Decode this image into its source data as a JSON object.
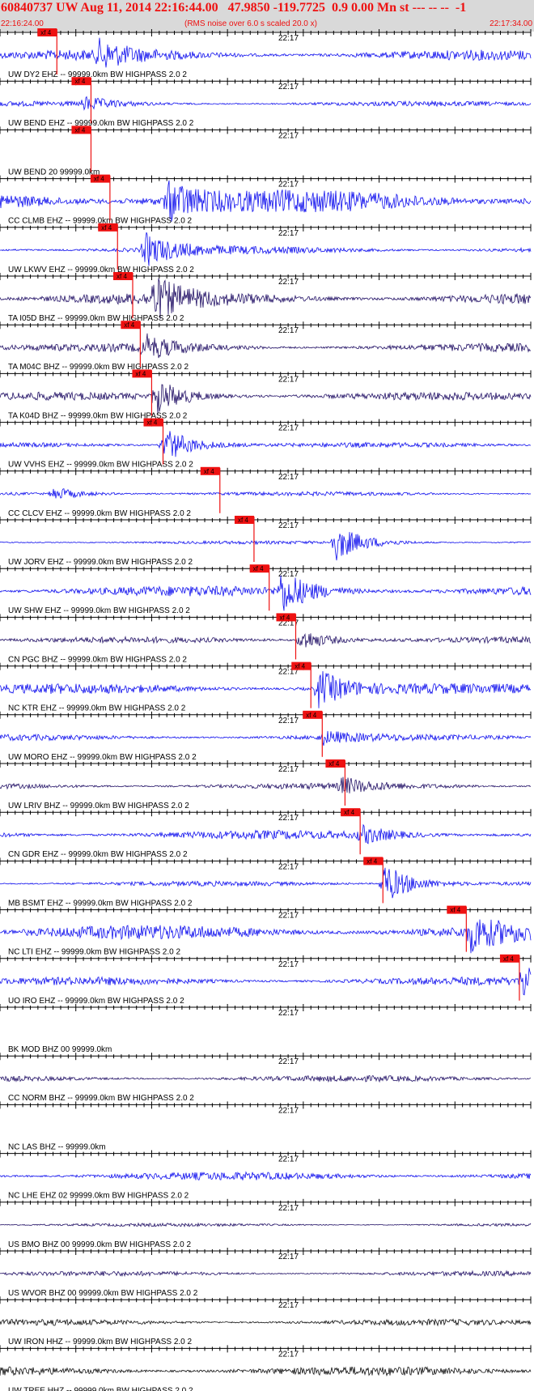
{
  "header": {
    "title": "60840737 UW Aug 11, 2014 22:16:44.00   47.9850 -119.7725  0.9 0.00 Mn st --- -- --  -1",
    "start_time": "22:16:24.00",
    "end_time": "22:17:34.00",
    "rms_note": "(RMS noise over 6.0 s scaled 20.0 x)"
  },
  "colors": {
    "trace_blue": "#1010ee",
    "trace_dark": "#221166",
    "trace_black": "#111111",
    "pick_red": "#ee1111",
    "axis": "#000000",
    "header_bg": "#d9d9d9"
  },
  "chart_data": {
    "type": "line",
    "x_range_seconds": [
      0,
      70
    ],
    "x_start_label": "22:16:24.00",
    "x_end_label": "22:17:34.00",
    "center_tick_label": "22:17",
    "pick_label": "xf 4",
    "traces": [
      {
        "label": "UW DY2 EHZ -- 99999.0km BW  HIGHPASS  2.0  2",
        "pick_s": 7.5,
        "color": "trace_blue",
        "noise": 0.25,
        "burst_s": 13,
        "burst_amp": 0.6
      },
      {
        "label": "UW BEND EHZ -- 99999.0km BW  HIGHPASS  2.0  2",
        "pick_s": 12.0,
        "color": "trace_blue",
        "noise": 0.12,
        "burst_s": 11,
        "burst_amp": 0.3
      },
      {
        "label": "UW BEND 20 99999.0km",
        "pick_s": 12.0,
        "color": "none",
        "noise": 0,
        "burst_s": 0,
        "burst_amp": 0
      },
      {
        "label": "CC CLMB EHZ -- 99999.0km BW  HIGHPASS  2.0  2",
        "pick_s": 14.5,
        "color": "trace_blue",
        "noise": 0.55,
        "burst_s": 22,
        "burst_amp": 1.0
      },
      {
        "label": "UW LKWV EHZ -- 99999.0km BW  HIGHPASS  2.0  2",
        "pick_s": 15.5,
        "color": "trace_blue",
        "noise": 0.18,
        "burst_s": 19,
        "burst_amp": 0.8
      },
      {
        "label": "TA I05D BHZ -- 99999.0km BW  HIGHPASS  2.0  2",
        "pick_s": 17.5,
        "color": "trace_dark",
        "noise": 0.3,
        "burst_s": 20,
        "burst_amp": 1.0
      },
      {
        "label": "TA M04C BHZ -- 99999.0km BW  HIGHPASS  2.0  2",
        "pick_s": 18.5,
        "color": "trace_dark",
        "noise": 0.2,
        "burst_s": 19,
        "burst_amp": 0.55
      },
      {
        "label": "TA K04D BHZ -- 99999.0km BW  HIGHPASS  2.0  2",
        "pick_s": 20.0,
        "color": "trace_dark",
        "noise": 0.2,
        "burst_s": 20.5,
        "burst_amp": 0.8
      },
      {
        "label": "UW VVHS EHZ -- 99999.0km BW  HIGHPASS  2.0  2",
        "pick_s": 21.5,
        "color": "trace_blue",
        "noise": 0.12,
        "burst_s": 21.5,
        "burst_amp": 0.9
      },
      {
        "label": "CC CLCV EHZ -- 99999.0km BW  HIGHPASS  2.0  2",
        "pick_s": 29.0,
        "color": "trace_blue",
        "noise": 0.1,
        "burst_s": 7,
        "burst_amp": 0.3
      },
      {
        "label": "UW JORV EHZ -- 99999.0km BW  HIGHPASS  2.0  2",
        "pick_s": 33.5,
        "color": "trace_blue",
        "noise": 0.08,
        "burst_s": 44,
        "burst_amp": 0.9
      },
      {
        "label": "UW SHW EHZ -- 99999.0km BW  HIGHPASS  2.0  2",
        "pick_s": 35.5,
        "color": "trace_blue",
        "noise": 0.25,
        "burst_s": 37,
        "burst_amp": 1.0
      },
      {
        "label": "CN PGC BHZ -- 99999.0km BW  HIGHPASS  2.0  2",
        "pick_s": 39.0,
        "color": "trace_dark",
        "noise": 0.15,
        "burst_s": 39.5,
        "burst_amp": 0.55
      },
      {
        "label": "NC KTR EHZ -- 99999.0km BW  HIGHPASS  2.0  2",
        "pick_s": 41.0,
        "color": "trace_blue",
        "noise": 0.25,
        "burst_s": 42,
        "burst_amp": 0.9
      },
      {
        "label": "UW MORO EHZ -- 99999.0km BW  HIGHPASS  2.0  2",
        "pick_s": 42.5,
        "color": "trace_blue",
        "noise": 0.15,
        "burst_s": 42.5,
        "burst_amp": 0.3
      },
      {
        "label": "UW LRIV BHZ -- 99999.0km BW  HIGHPASS  2.0  2",
        "pick_s": 45.5,
        "color": "trace_dark",
        "noise": 0.15,
        "burst_s": 45,
        "burst_amp": 0.35
      },
      {
        "label": "CN GDR EHZ -- 99999.0km BW  HIGHPASS  2.0  2",
        "pick_s": 47.5,
        "color": "trace_blue",
        "noise": 0.22,
        "burst_s": 47.5,
        "burst_amp": 0.4
      },
      {
        "label": "MB BSMT EHZ -- 99999.0km BW  HIGHPASS  2.0  2",
        "pick_s": 50.5,
        "color": "trace_blue",
        "noise": 0.12,
        "burst_s": 50.5,
        "burst_amp": 1.0
      },
      {
        "label": "NC LTI EHZ -- 99999.0km BW  HIGHPASS  2.0  2",
        "pick_s": 61.5,
        "color": "trace_blue",
        "noise": 0.35,
        "burst_s": 62,
        "burst_amp": 0.8
      },
      {
        "label": "UO IRO EHZ -- 99999.0km BW  HIGHPASS  2.0  2",
        "pick_s": 68.5,
        "color": "trace_blue",
        "noise": 0.2,
        "burst_s": 69,
        "burst_amp": 1.0
      },
      {
        "label": "BK MOD BHZ 00 99999.0km",
        "pick_s": null,
        "color": "none",
        "noise": 0,
        "burst_s": 0,
        "burst_amp": 0
      },
      {
        "label": "CC NORM BHZ -- 99999.0km BW  HIGHPASS  2.0  2",
        "pick_s": null,
        "color": "trace_dark",
        "noise": 0.15,
        "burst_s": 0,
        "burst_amp": 0
      },
      {
        "label": "NC LAS BHZ -- 99999.0km",
        "pick_s": null,
        "color": "none",
        "noise": 0,
        "burst_s": 0,
        "burst_amp": 0
      },
      {
        "label": "NC LHE EHZ 02 99999.0km BW  HIGHPASS  2.0  2",
        "pick_s": null,
        "color": "trace_blue",
        "noise": 0.2,
        "burst_s": 0,
        "burst_amp": 0
      },
      {
        "label": "US BMO BHZ 00 99999.0km BW  HIGHPASS  2.0  2",
        "pick_s": null,
        "color": "trace_dark",
        "noise": 0.08,
        "burst_s": 0,
        "burst_amp": 0
      },
      {
        "label": "US WVOR BHZ 00 99999.0km BW  HIGHPASS  2.0  2",
        "pick_s": null,
        "color": "trace_dark",
        "noise": 0.12,
        "burst_s": 0,
        "burst_amp": 0
      },
      {
        "label": "UW IRON HHZ -- 99999.0km BW  HIGHPASS  2.0  2",
        "pick_s": null,
        "color": "trace_black",
        "noise": 0.15,
        "burst_s": 0,
        "burst_amp": 0
      },
      {
        "label": "UW TREE HHZ -- 99999.0km BW  HIGHPASS  2.0  2",
        "pick_s": null,
        "color": "trace_black",
        "noise": 0.22,
        "burst_s": 0,
        "burst_amp": 0
      }
    ]
  }
}
